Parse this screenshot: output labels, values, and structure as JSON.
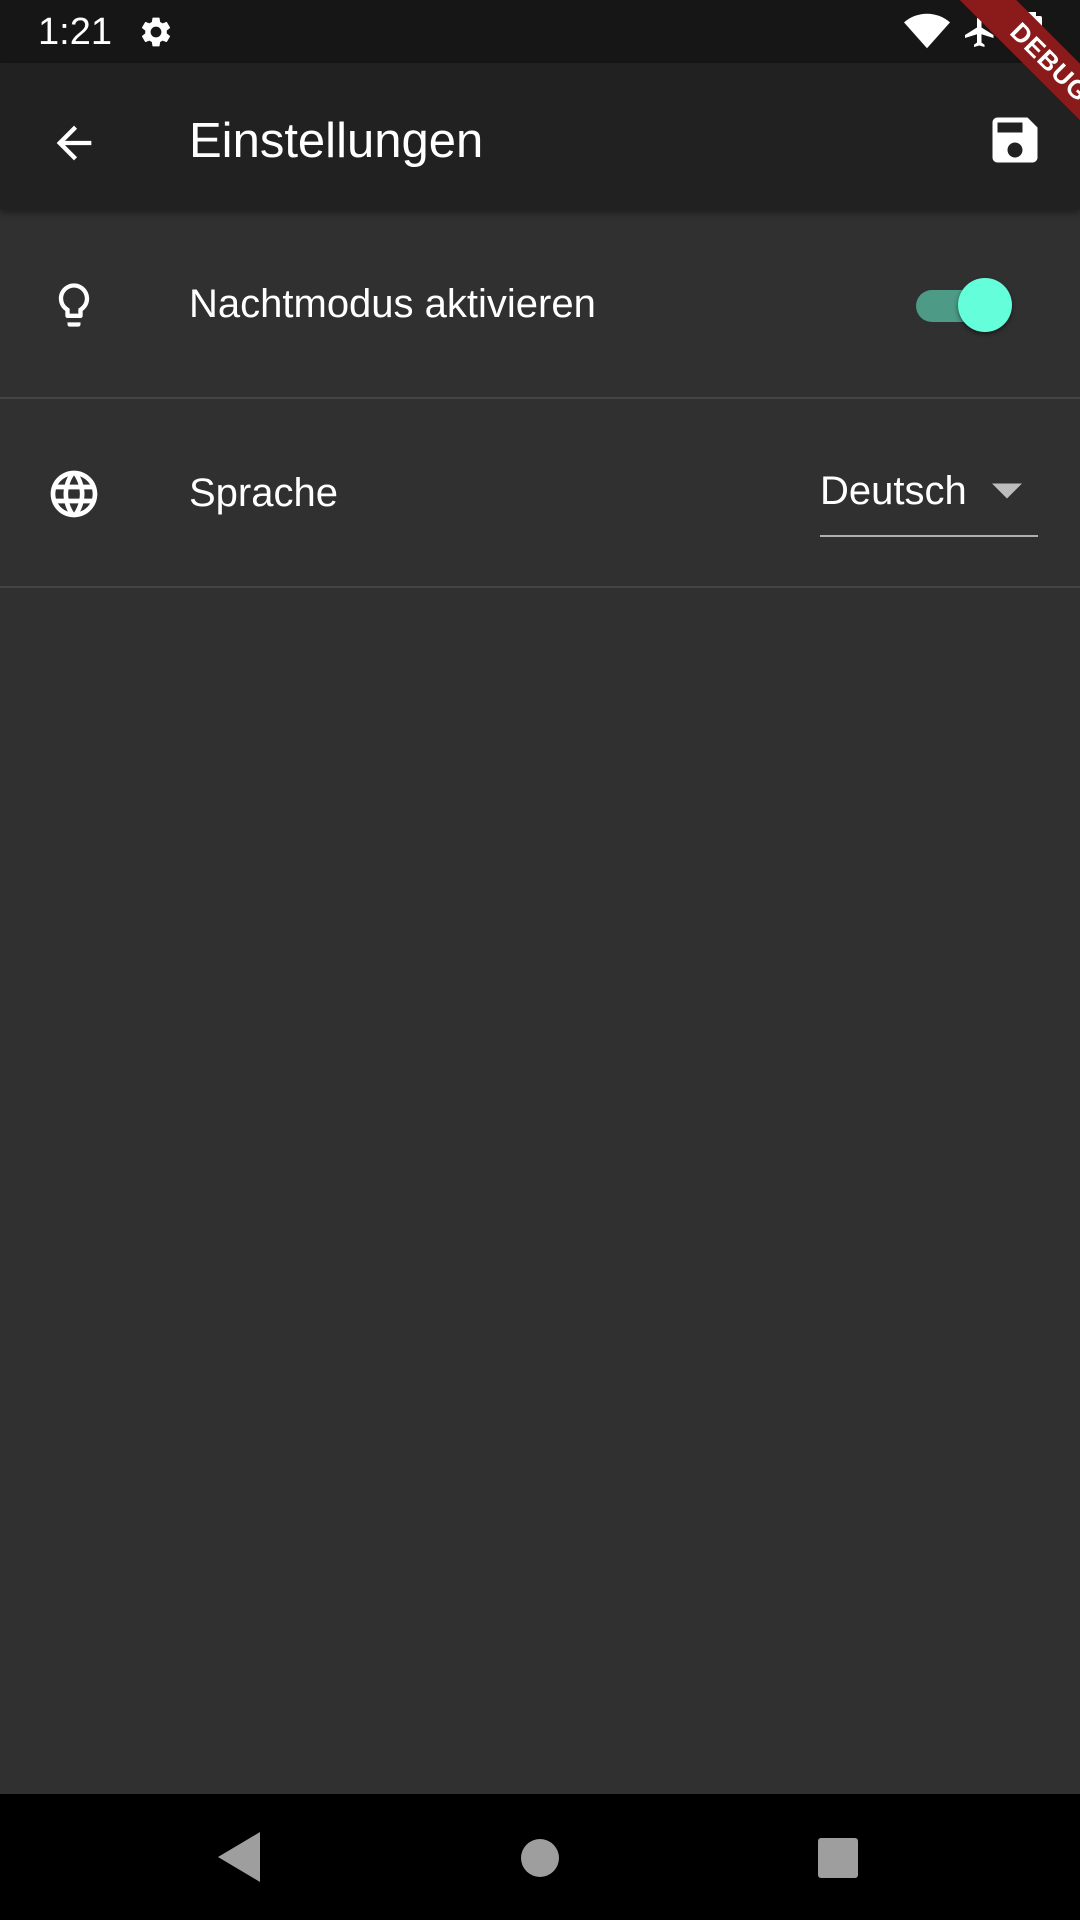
{
  "status_bar": {
    "time": "1:21",
    "icons": [
      "gear-icon",
      "wifi-icon",
      "airplane-icon",
      "battery-icon"
    ]
  },
  "app_bar": {
    "title": "Einstellungen",
    "back_icon": "arrow-back-icon",
    "save_icon": "save-icon",
    "background": "#212121"
  },
  "debug_banner": "DEBUG",
  "settings": {
    "night_mode": {
      "label": "Nachtmodus aktivieren",
      "icon": "lightbulb-icon",
      "enabled": true,
      "accent": "#64ffda"
    },
    "language": {
      "label": "Sprache",
      "icon": "globe-icon",
      "selected": "Deutsch"
    }
  },
  "nav_bar": {
    "icons": [
      "nav-back-icon",
      "nav-home-icon",
      "nav-recents-icon"
    ]
  },
  "colors": {
    "background": "#303030",
    "status_bar": "#161616",
    "nav_bar": "#000000",
    "debug": "#8b1a1a"
  }
}
